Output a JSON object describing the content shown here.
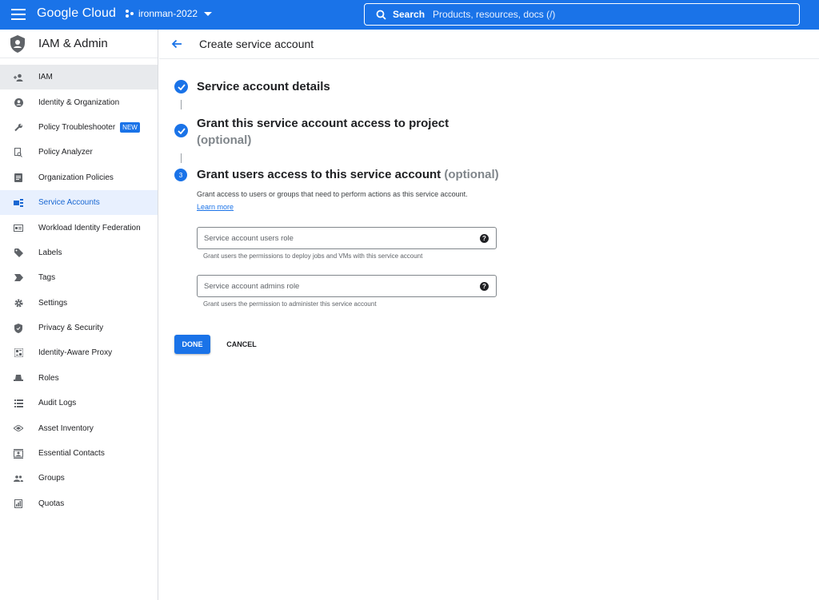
{
  "topbar": {
    "logo": "Google Cloud",
    "project": "ironman-2022",
    "search_label": "Search",
    "search_placeholder": "Products, resources, docs (/)"
  },
  "sidebar": {
    "title": "IAM & Admin",
    "items": [
      {
        "label": "IAM",
        "icon": "person-add-icon"
      },
      {
        "label": "Identity & Organization",
        "icon": "account-circle-icon"
      },
      {
        "label": "Policy Troubleshooter",
        "icon": "wrench-icon",
        "badge": "NEW"
      },
      {
        "label": "Policy Analyzer",
        "icon": "document-search-icon"
      },
      {
        "label": "Organization Policies",
        "icon": "list-document-icon"
      },
      {
        "label": "Service Accounts",
        "icon": "service-account-icon"
      },
      {
        "label": "Workload Identity Federation",
        "icon": "id-card-icon"
      },
      {
        "label": "Labels",
        "icon": "label-icon"
      },
      {
        "label": "Tags",
        "icon": "tag-arrow-icon"
      },
      {
        "label": "Settings",
        "icon": "gear-icon"
      },
      {
        "label": "Privacy & Security",
        "icon": "shield-icon"
      },
      {
        "label": "Identity-Aware Proxy",
        "icon": "proxy-icon"
      },
      {
        "label": "Roles",
        "icon": "hat-icon"
      },
      {
        "label": "Audit Logs",
        "icon": "list-icon"
      },
      {
        "label": "Asset Inventory",
        "icon": "diamond-icon"
      },
      {
        "label": "Essential Contacts",
        "icon": "contacts-icon"
      },
      {
        "label": "Groups",
        "icon": "group-icon"
      },
      {
        "label": "Quotas",
        "icon": "quota-icon"
      }
    ]
  },
  "main": {
    "page_title": "Create service account",
    "step1": {
      "title": "Service account details"
    },
    "step2": {
      "title": "Grant this service account access to project",
      "optional": "(optional)"
    },
    "step3": {
      "number": "3",
      "title": "Grant users access to this service account",
      "optional": "(optional)",
      "description": "Grant access to users or groups that need to perform actions as this service account.",
      "learn_more": "Learn more"
    },
    "fields": {
      "users_role": {
        "placeholder": "Service account users role",
        "hint": "Grant users the permissions to deploy jobs and VMs with this service account"
      },
      "admins_role": {
        "placeholder": "Service account admins role",
        "hint": "Grant users the permission to administer this service account"
      }
    },
    "buttons": {
      "done": "DONE",
      "cancel": "CANCEL"
    }
  },
  "colors": {
    "accent": "#1a73e8",
    "selected_bg": "#e8f0fe",
    "active_bg": "#e8eaed"
  }
}
